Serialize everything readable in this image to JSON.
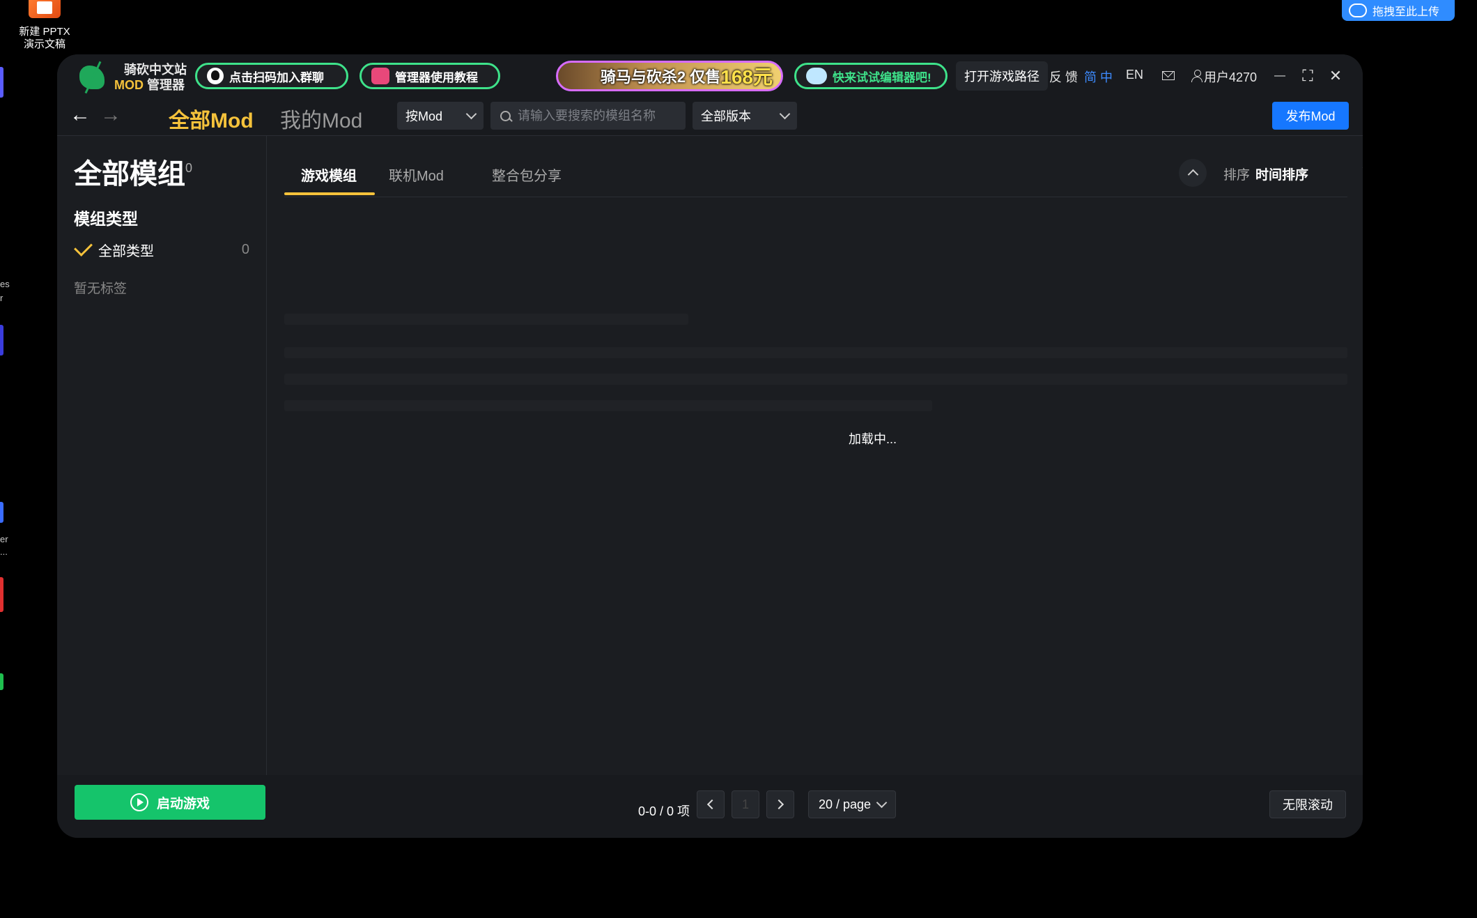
{
  "desktop": {
    "icon_label_line1": "新建 PPTX",
    "icon_label_line2": "演示文稿",
    "upload_label": "拖拽至此上传",
    "edge_texts": [
      "es",
      "r",
      "er",
      "..."
    ]
  },
  "titlebar": {
    "logo_line1": "骑砍中文站",
    "logo_mod": "MOD",
    "logo_manager": "管理器",
    "qq_pill": "点击扫码加入群聊",
    "tutorial_pill": "管理器使用教程",
    "banner_text": "骑马与砍杀2 仅售",
    "banner_price": "168元",
    "editor_pill": "快来试试编辑器吧!",
    "open_game_path": "打开游戏路径",
    "feedback": "反 馈",
    "lang_zh": "简 中",
    "lang_en": "EN",
    "user": "用户4270",
    "minimize": "—",
    "maximize": "⛶",
    "close": "✕"
  },
  "nav": {
    "back": "←",
    "forward": "→",
    "tab_all": "全部Mod",
    "tab_my": "我的Mod",
    "filter_select": "按Mod",
    "search_placeholder": "请输入要搜索的模组名称",
    "version_select": "全部版本",
    "publish": "发布Mod"
  },
  "sidebar": {
    "title": "全部模组",
    "title_count": "0",
    "subtitle": "模组类型",
    "type_label": "全部类型",
    "type_count": "0",
    "no_tag": "暂无标签"
  },
  "main": {
    "tabs": [
      {
        "label": "游戏模组"
      },
      {
        "label": "联机Mod"
      },
      {
        "label": "整合包分享"
      }
    ],
    "sort_label": "排序",
    "sort_value": "时间排序",
    "loading": "加载中..."
  },
  "footer": {
    "start_game": "启动游戏",
    "range": "0-0 / 0 项",
    "current_page": "1",
    "per_page": "20 / page",
    "infinite_scroll": "无限滚动"
  },
  "colors": {
    "accent_yellow": "#f5c23b",
    "primary_blue": "#1677ff",
    "start_green": "#15c46b",
    "pill_border_green": "#3ee28a"
  }
}
